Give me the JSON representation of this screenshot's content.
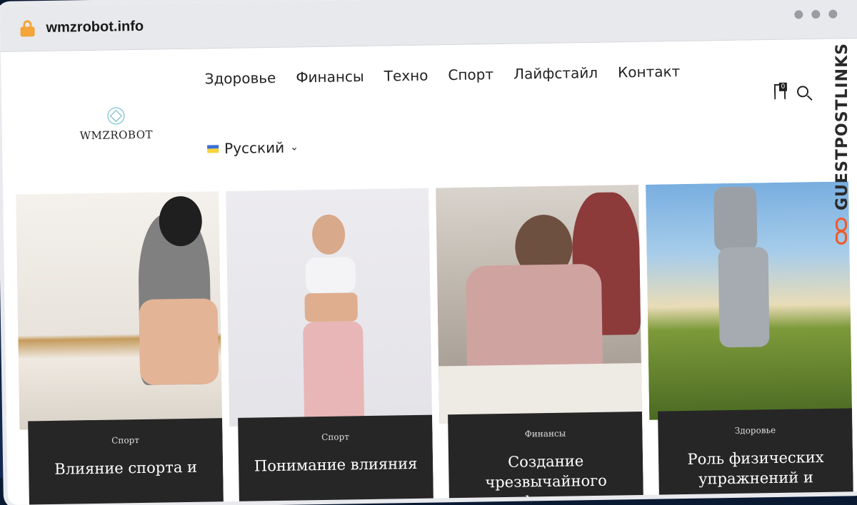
{
  "browser": {
    "url": "wmzrobot.info"
  },
  "site": {
    "logo_text": "WMZROBOT",
    "nav": [
      "Здоровье",
      "Финансы",
      "Техно",
      "Спорт",
      "Лайфстайл",
      "Контакт"
    ],
    "language": "Русский",
    "bookmark_count": "0"
  },
  "cards": [
    {
      "category": "Спорт",
      "title": "Влияние спорта и"
    },
    {
      "category": "Спорт",
      "title": "Понимание влияния"
    },
    {
      "category": "Финансы",
      "title": "Создание чрезвычайного фонда"
    },
    {
      "category": "Здоровье",
      "title": "Роль физических упражнений и"
    }
  ],
  "watermark": "GUESTPOSTLINKS",
  "colors": {
    "lock": "#f3a53a",
    "card_bg": "#262626",
    "watermark_accent": "#f05a28"
  }
}
